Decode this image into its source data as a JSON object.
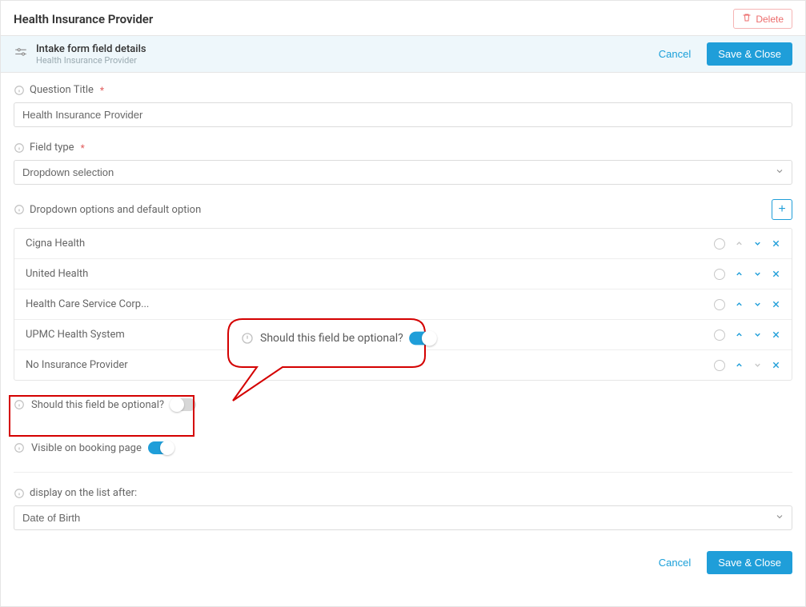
{
  "header": {
    "pageTitle": "Health Insurance Provider",
    "deleteLabel": "Delete"
  },
  "subheader": {
    "title": "Intake form field details",
    "subtitle": "Health Insurance Provider",
    "cancelLabel": "Cancel",
    "saveLabel": "Save & Close"
  },
  "questionTitle": {
    "label": "Question Title",
    "value": "Health Insurance Provider"
  },
  "fieldType": {
    "label": "Field type",
    "value": "Dropdown selection"
  },
  "dropdownOptions": {
    "label": "Dropdown options and default option",
    "items": [
      {
        "label": "Cigna Health"
      },
      {
        "label": "United Health"
      },
      {
        "label": "Health Care Service Corp..."
      },
      {
        "label": "UPMC Health System"
      },
      {
        "label": "No Insurance Provider"
      }
    ]
  },
  "optionalField": {
    "label": "Should this field be optional?",
    "on": false
  },
  "visible": {
    "label": "Visible on booking page",
    "on": true
  },
  "displayAfter": {
    "label": "display on the list after:",
    "value": "Date of Birth"
  },
  "callout": {
    "label": "Should this field be optional?"
  },
  "footer": {
    "cancelLabel": "Cancel",
    "saveLabel": "Save & Close"
  }
}
